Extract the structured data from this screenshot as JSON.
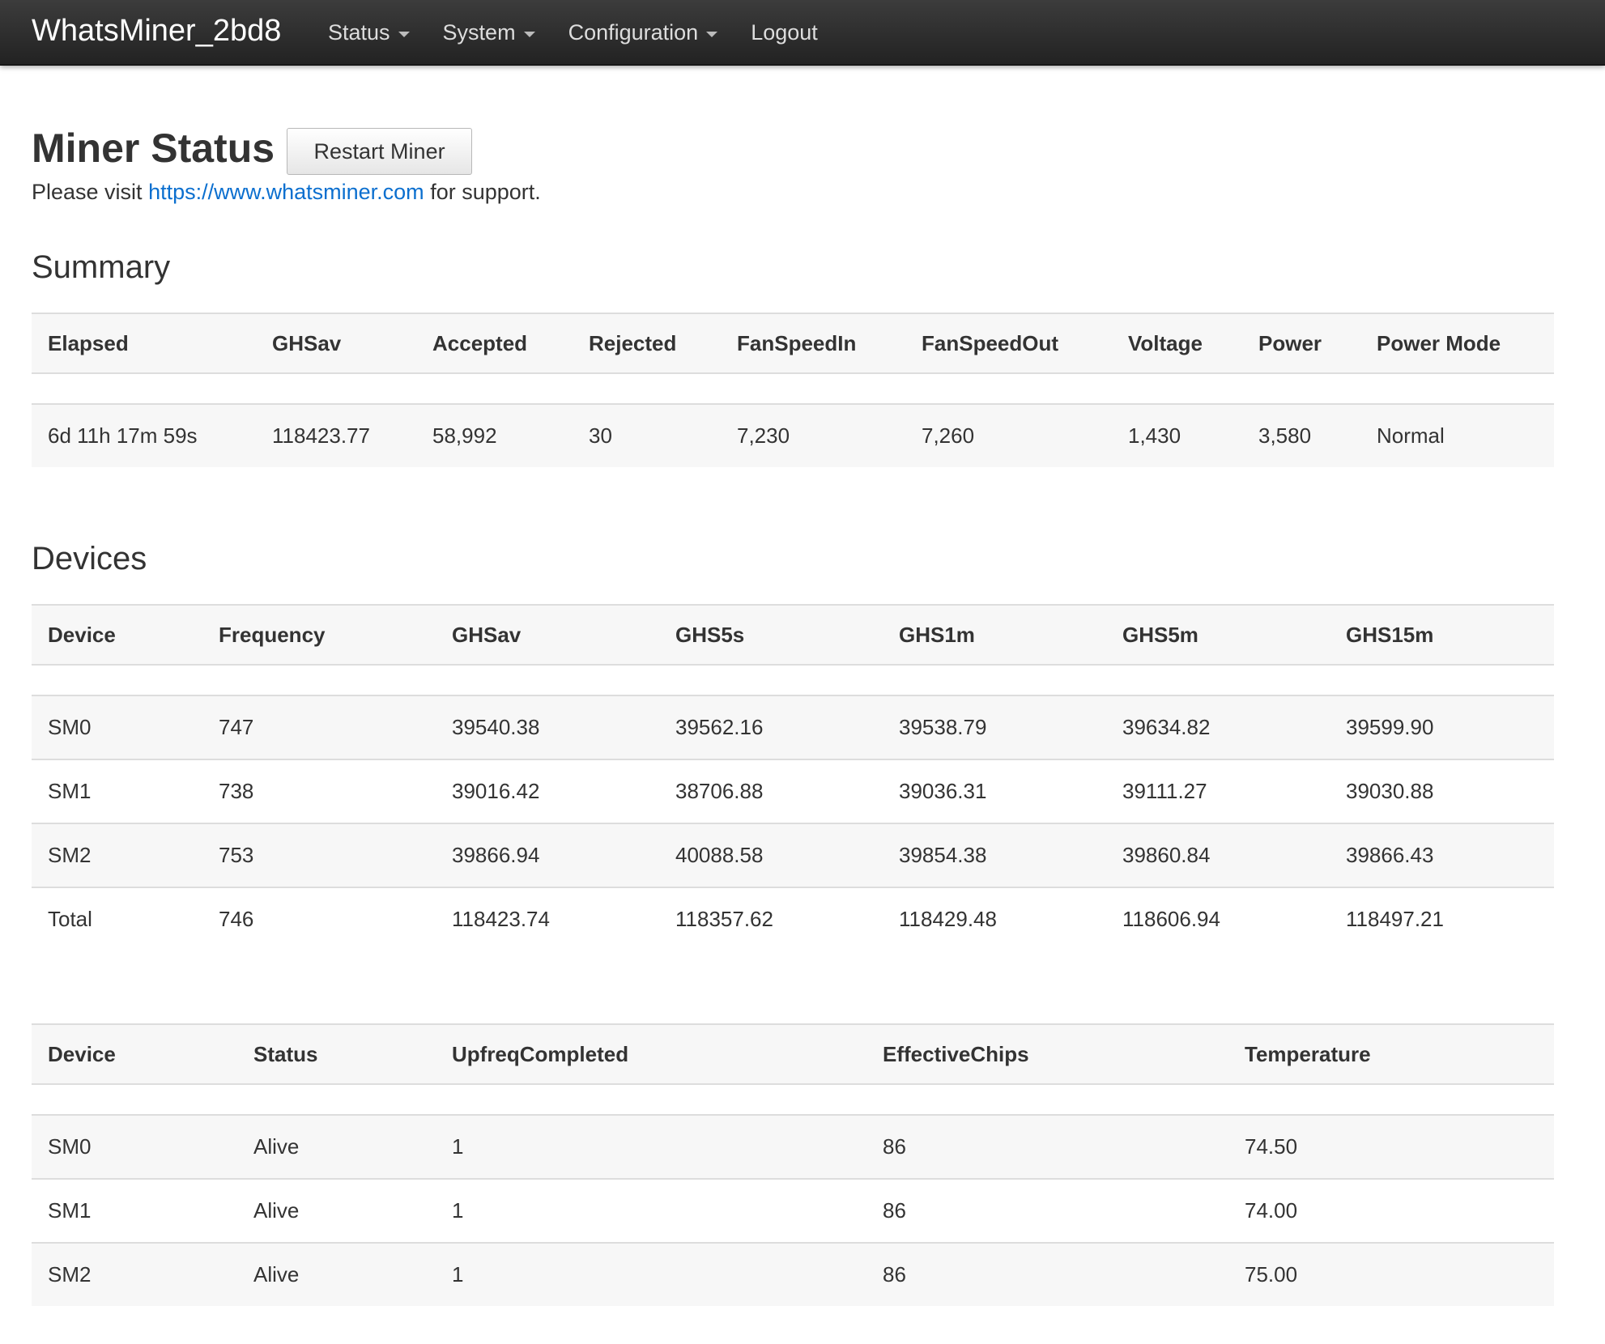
{
  "nav": {
    "brand": "WhatsMiner_2bd8",
    "items": [
      {
        "label": "Status",
        "dropdown": true
      },
      {
        "label": "System",
        "dropdown": true
      },
      {
        "label": "Configuration",
        "dropdown": true
      },
      {
        "label": "Logout",
        "dropdown": false
      }
    ]
  },
  "page": {
    "title": "Miner Status",
    "restart_label": "Restart Miner",
    "support_prefix": "Please visit ",
    "support_link": "https://www.whatsminer.com",
    "support_suffix": " for support."
  },
  "summary": {
    "title": "Summary",
    "headers": [
      "Elapsed",
      "GHSav",
      "Accepted",
      "Rejected",
      "FanSpeedIn",
      "FanSpeedOut",
      "Voltage",
      "Power",
      "Power Mode"
    ],
    "row": [
      "6d 11h 17m 59s",
      "118423.77",
      "58,992",
      "30",
      "7,230",
      "7,260",
      "1,430",
      "3,580",
      "Normal"
    ]
  },
  "devices": {
    "title": "Devices",
    "headers": [
      "Device",
      "Frequency",
      "GHSav",
      "GHS5s",
      "GHS1m",
      "GHS5m",
      "GHS15m"
    ],
    "rows": [
      [
        "SM0",
        "747",
        "39540.38",
        "39562.16",
        "39538.79",
        "39634.82",
        "39599.90"
      ],
      [
        "SM1",
        "738",
        "39016.42",
        "38706.88",
        "39036.31",
        "39111.27",
        "39030.88"
      ],
      [
        "SM2",
        "753",
        "39866.94",
        "40088.58",
        "39854.38",
        "39860.84",
        "39866.43"
      ],
      [
        "Total",
        "746",
        "118423.74",
        "118357.62",
        "118429.48",
        "118606.94",
        "118497.21"
      ]
    ]
  },
  "device_status": {
    "headers": [
      "Device",
      "Status",
      "UpfreqCompleted",
      "EffectiveChips",
      "Temperature"
    ],
    "rows": [
      [
        "SM0",
        "Alive",
        "1",
        "86",
        "74.50"
      ],
      [
        "SM1",
        "Alive",
        "1",
        "86",
        "74.00"
      ],
      [
        "SM2",
        "Alive",
        "1",
        "86",
        "75.00"
      ]
    ]
  }
}
